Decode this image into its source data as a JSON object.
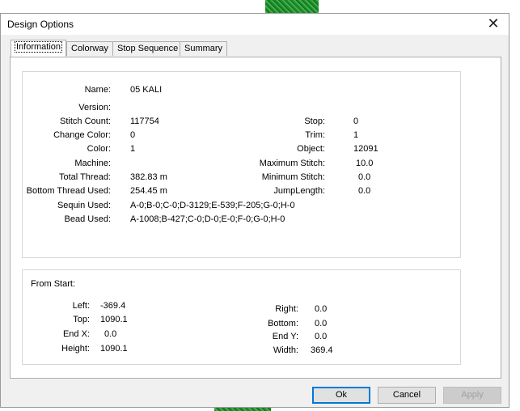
{
  "window": {
    "title": "Design Options"
  },
  "tabs": [
    {
      "label": "Information",
      "active": true
    },
    {
      "label": "Colorway",
      "active": false
    },
    {
      "label": "Stop Sequence",
      "active": false
    },
    {
      "label": "Summary",
      "active": false
    }
  ],
  "info": {
    "name_label": "Name:",
    "name_value": "05 KALI",
    "version_label": "Version:",
    "version_value": "",
    "stitch_count_label": "Stitch Count:",
    "stitch_count_value": "117754",
    "change_color_label": "Change Color:",
    "change_color_value": "0",
    "color_label": "Color:",
    "color_value": "1",
    "machine_label": "Machine:",
    "machine_value": "",
    "total_thread_label": "Total Thread:",
    "total_thread_value": "382.83 m",
    "bottom_thread_label": "Bottom Thread Used:",
    "bottom_thread_value": "254.45 m",
    "sequin_label": "Sequin Used:",
    "sequin_value": "A-0;B-0;C-0;D-3129;E-539;F-205;G-0;H-0",
    "bead_label": "Bead Used:",
    "bead_value": "A-1008;B-427;C-0;D-0;E-0;F-0;G-0;H-0",
    "stop_label": "Stop:",
    "stop_value": "0",
    "trim_label": "Trim:",
    "trim_value": "1",
    "object_label": "Object:",
    "object_value": "12091",
    "max_stitch_label": "Maximum Stitch:",
    "max_stitch_value": "10.0",
    "min_stitch_label": "Minimum Stitch:",
    "min_stitch_value": "0.0",
    "jump_length_label": "JumpLength:",
    "jump_length_value": "0.0"
  },
  "from_start": {
    "title": "From Start:",
    "left_label": "Left:",
    "left_value": "-369.4",
    "top_label": "Top:",
    "top_value": "1090.1",
    "endx_label": "End X:",
    "endx_value": "0.0",
    "height_label": "Height:",
    "height_value": "1090.1",
    "right_label": "Right:",
    "right_value": "0.0",
    "bottom_label": "Bottom:",
    "bottom_value": "0.0",
    "endy_label": "End Y:",
    "endy_value": "0.0",
    "width_label": "Width:",
    "width_value": "369.4"
  },
  "buttons": {
    "ok": "Ok",
    "cancel": "Cancel",
    "apply": "Apply"
  },
  "colors": {
    "accent": "#0078d7",
    "panel": "#f0f0f0"
  }
}
